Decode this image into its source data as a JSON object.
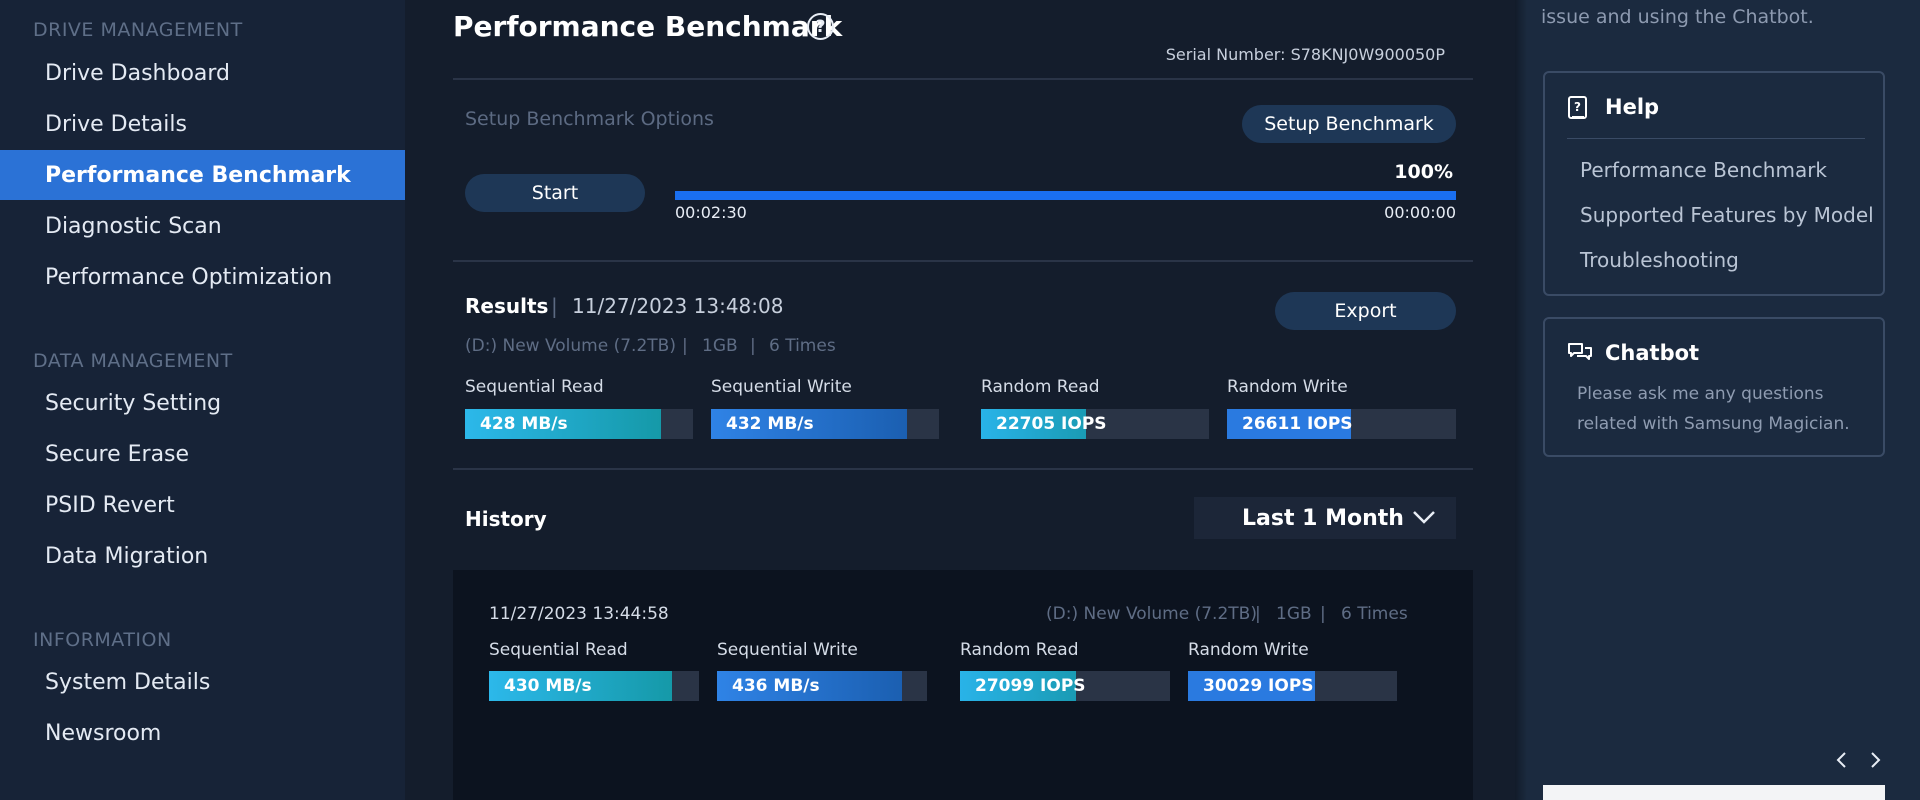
{
  "sidebar": {
    "sections": [
      {
        "title": "DRIVE MANAGEMENT",
        "items": [
          "Drive Dashboard",
          "Drive Details",
          "Performance Benchmark",
          "Diagnostic Scan",
          "Performance Optimization"
        ]
      },
      {
        "title": "DATA MANAGEMENT",
        "items": [
          "Security Setting",
          "Secure Erase",
          "PSID Revert",
          "Data Migration"
        ]
      },
      {
        "title": "INFORMATION",
        "items": [
          "System Details",
          "Newsroom"
        ]
      }
    ],
    "active_item": "Performance Benchmark"
  },
  "header": {
    "title": "Performance Benchmark",
    "help_glyph": "?",
    "serial_label": "Serial Number: S78KNJ0W900050P"
  },
  "setup": {
    "label": "Setup Benchmark Options",
    "setup_button": "Setup Benchmark",
    "start_button": "Start",
    "progress_percent": 100,
    "progress_text": "100%",
    "elapsed": "00:02:30",
    "remaining": "00:00:00"
  },
  "results": {
    "label": "Results",
    "separator": "|",
    "datetime": "11/27/2023 13:48:08",
    "volume": "(D:) New Volume (7.2TB)",
    "size": "1GB",
    "times": "6 Times",
    "export_button": "Export",
    "metrics": [
      {
        "label": "Sequential Read",
        "value": "428 MB/s",
        "fill": 0.86
      },
      {
        "label": "Sequential Write",
        "value": "432 MB/s",
        "fill": 0.86
      },
      {
        "label": "Random Read",
        "value": "22705 IOPS",
        "fill": 0.46
      },
      {
        "label": "Random Write",
        "value": "26611 IOPS",
        "fill": 0.54
      }
    ]
  },
  "history": {
    "label": "History",
    "filter_selected": "Last 1 Month",
    "entries": [
      {
        "datetime": "11/27/2023 13:44:58",
        "volume": "(D:) New Volume (7.2TB)",
        "size": "1GB",
        "times": "6 Times",
        "metrics": [
          {
            "label": "Sequential Read",
            "value": "430 MB/s",
            "fill": 0.87
          },
          {
            "label": "Sequential Write",
            "value": "436 MB/s",
            "fill": 0.88
          },
          {
            "label": "Random Read",
            "value": "27099 IOPS",
            "fill": 0.55
          },
          {
            "label": "Random Write",
            "value": "30029 IOPS",
            "fill": 0.61
          }
        ]
      }
    ]
  },
  "right_panel": {
    "top_text": "issue and using the Chatbot.",
    "help": {
      "title": "Help",
      "links": [
        "Performance Benchmark",
        "Supported Features by Model",
        "Troubleshooting"
      ]
    },
    "chatbot": {
      "title": "Chatbot",
      "description_lines": [
        "Please ask me any questions",
        "related with Samsung Magician."
      ]
    }
  },
  "colors": {
    "accent": "#2b72d6",
    "progress": "#1a6ff0",
    "sidebar_bg": "#172337",
    "main_bg": "#141d2c",
    "right_bg": "#1b2a3f"
  }
}
